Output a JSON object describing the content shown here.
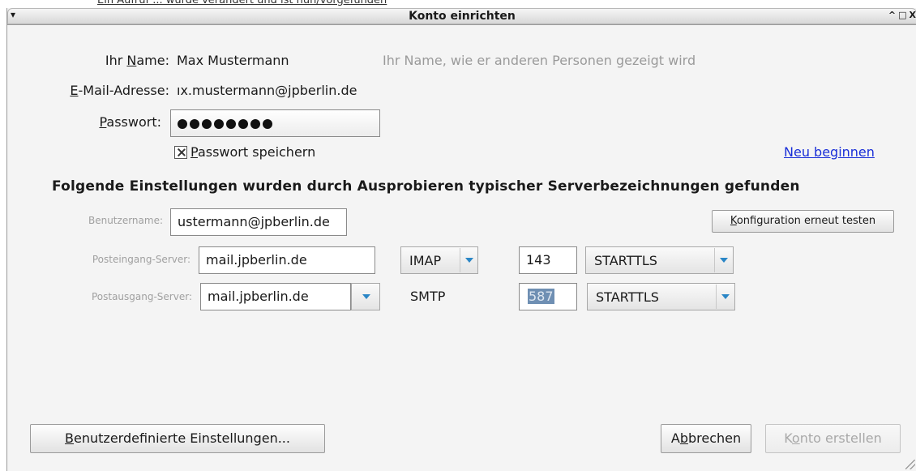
{
  "background": {
    "partial_text": "Ein Aufruf ... wurde verändert und ist nun/vorgefunden"
  },
  "window": {
    "title": "Konto einrichten",
    "menu_glyph": "▾",
    "controls": [
      "^",
      "□",
      "X"
    ]
  },
  "account": {
    "name_label_pre": "Ihr ",
    "name_label_key": "N",
    "name_label_post": "ame:",
    "name_value": "Max Mustermann",
    "name_hint": "Ihr Name, wie er anderen Personen gezeigt wird",
    "email_label_key": "E",
    "email_label_post": "-Mail-Adresse:",
    "email_value": "ıx.mustermann@jpberlin.de",
    "password_label_key": "P",
    "password_label_post": "asswort:",
    "password_dots": 8,
    "remember_key": "P",
    "remember_post": "asswort speichern",
    "remember_checked": true,
    "restart_link": "Neu beginnen"
  },
  "settings": {
    "heading": "Folgende Einstellungen wurden durch Ausprobieren typischer Serverbezeichnungen gefunden",
    "username_label": "Benutzername:",
    "username_value": "ustermann@jpberlin.de",
    "retest_key": "K",
    "retest_post": "onfiguration erneut testen",
    "incoming_label": "Posteingang-Server:",
    "incoming_server": "mail.jpberlin.de",
    "incoming_protocol": "IMAP",
    "incoming_port": "143",
    "incoming_security": "STARTTLS",
    "outgoing_label": "Postausgang-Server:",
    "outgoing_server": "mail.jpberlin.de",
    "outgoing_protocol": "SMTP",
    "outgoing_port": "587",
    "outgoing_security": "STARTTLS"
  },
  "buttons": {
    "custom_key": "B",
    "custom_post": "enutzerdefinierte Einstellungen...",
    "cancel_pre": "A",
    "cancel_key": "b",
    "cancel_post": "brechen",
    "create_pre": "K",
    "create_key": "o",
    "create_post": "nto erstellen"
  },
  "colors": {
    "link": "#1a2fd8",
    "combo_arrow": "#2a86c6",
    "port_selection": "#6f8fb3"
  }
}
